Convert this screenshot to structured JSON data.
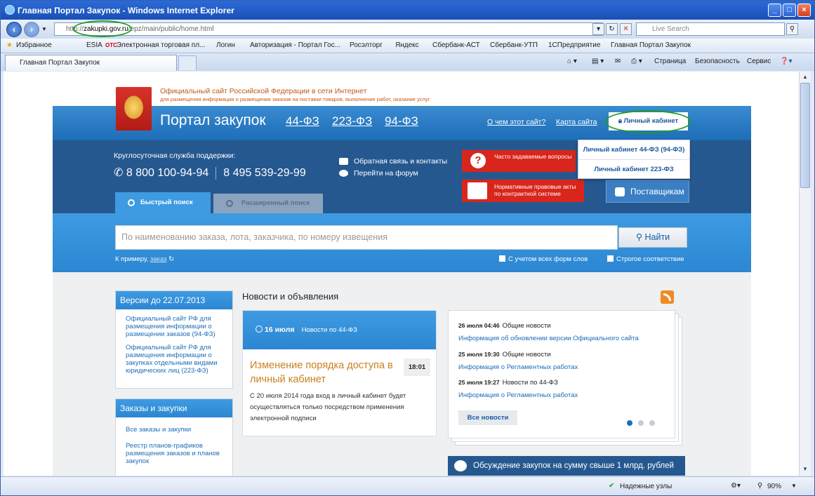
{
  "window": {
    "title": "Главная Портал Закупок - Windows Internet Explorer",
    "min": "_",
    "max": "□",
    "close": "×"
  },
  "address": {
    "url_prefix": "http://",
    "url_domain": "zakupki.gov.ru",
    "url_rest": "/epz/main/public/home.html",
    "search_placeholder": "Live Search"
  },
  "favorites": {
    "label": "Избранное",
    "items": [
      "ESIA",
      "Электронная торговая пл...",
      "Логин",
      "Авторизация - Портал Гос...",
      "Росэлторг",
      "Яндекс",
      "Сбербанк-АСТ",
      "Сбербанк-УТП",
      "1СПредприятие",
      "Главная Портал Закупок"
    ],
    "prefix_otc": "OTC"
  },
  "tabs": {
    "active": "Главная Портал Закупок"
  },
  "commandbar": {
    "page": "Страница",
    "safety": "Безопасность",
    "service": "Сервис"
  },
  "site": {
    "official_line": "Официальный сайт Российской Федерации в сети Интернет",
    "official_sub": "для размещения информации о размещении заказов на поставки товаров, выполнение работ, оказание услуг",
    "portal_name": "Портал закупок",
    "laws": [
      "44-ФЗ",
      "223-ФЗ",
      "94-ФЗ"
    ],
    "about": "О чем этот сайт?",
    "sitemap": "Карта сайта",
    "cabinet": "Личный кабинет",
    "cabinet_menu": [
      "Личный кабинет 44-ФЗ (94-ФЗ)",
      "Личный кабинет 223-ФЗ"
    ],
    "support_label": "Круглосуточная служба поддержки:",
    "phone1": "8 800 100-94-94",
    "phone2": "8 495 539-29-99",
    "feedback": "Обратная связь и контакты",
    "forum": "Перейти на форум",
    "faq": "Часто задаваемые вопросы",
    "laws_link": "Нормативные правовые акты по контрактной системе",
    "suppliers": "Поставщикам",
    "tab_quick": "Быстрый поиск",
    "tab_ext": "Расширенный поиск",
    "search_placeholder": "По наименованию заказа, лота, заказчика, по номеру извещения",
    "search_btn": "Найти",
    "example_label": "К примеру,",
    "example_word": "заказ",
    "cb_forms": "С учетом всех форм слов",
    "cb_strict": "Строгое соответствие"
  },
  "sidebar": {
    "versions_title": "Версии до 22.07.2013",
    "versions": [
      "Официальный сайт РФ для размещения информации о размещении заказов (94-ФЗ)",
      "Официальный сайт РФ для размещения информации о закупках отдельными видами юридических лиц (223-ФЗ)"
    ],
    "orders_title": "Заказы и закупки",
    "orders": [
      "Все заказы и закупки",
      "Реестр планов-графиков размещения заказов и планов закупок"
    ]
  },
  "news": {
    "heading": "Новости и объявления",
    "feature_date": "16 июля",
    "feature_cat": "Новости по 44-ФЗ",
    "feature_title": "Изменение порядка доступа в личный кабинет",
    "feature_time": "18:01",
    "feature_text": "С 20 июля 2014 года вход в личный кабинет будет осуществляться только посредством применения электронной подписи",
    "items": [
      {
        "date": "26 июля 04:46",
        "cat": "Общие новости",
        "link": "Информация об обновлении версии Официального сайта"
      },
      {
        "date": "25 июля 19:30",
        "cat": "Общие новости",
        "link": "Информация о Регламентных работах"
      },
      {
        "date": "25 июля 19:27",
        "cat": "Новости по 44-ФЗ",
        "link": "Информация о Регламентных работах"
      }
    ],
    "all_news": "Все новости",
    "discussion": "Обсуждение закупок на сумму свыше 1 млрд. рублей"
  },
  "statusbar": {
    "trusted": "Надежные узлы",
    "zoom": "90%"
  }
}
